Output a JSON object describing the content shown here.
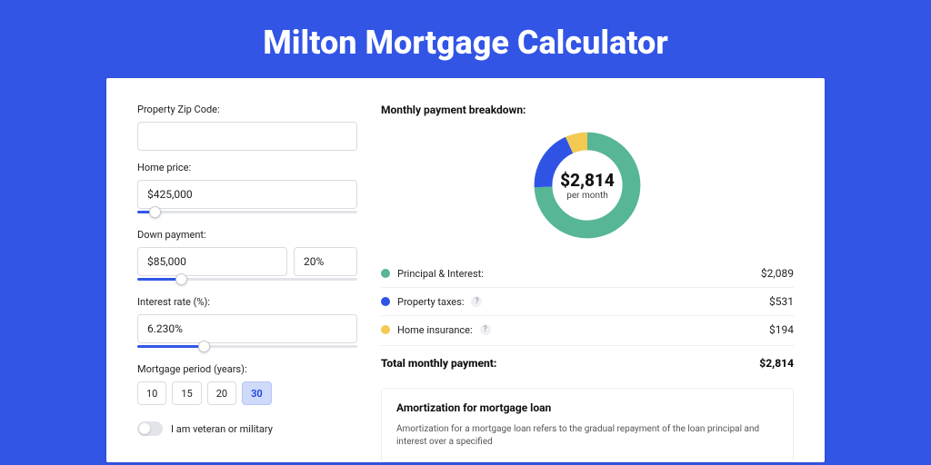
{
  "title": "Milton Mortgage Calculator",
  "form": {
    "zip": {
      "label": "Property Zip Code:",
      "value": ""
    },
    "price": {
      "label": "Home price:",
      "value": "$425,000",
      "slider_pct": 8
    },
    "down": {
      "label": "Down payment:",
      "value": "$85,000",
      "pct": "20%",
      "slider_pct": 20
    },
    "rate": {
      "label": "Interest rate (%):",
      "value": "6.230%",
      "slider_pct": 30
    },
    "period": {
      "label": "Mortgage period (years):",
      "options": [
        "10",
        "15",
        "20",
        "30"
      ],
      "selected": "30"
    },
    "veteran": {
      "label": "I am veteran or military",
      "on": false
    }
  },
  "breakdown": {
    "title": "Monthly payment breakdown:",
    "center_amount": "$2,814",
    "center_sub": "per month",
    "items": [
      {
        "label": "Principal & Interest:",
        "value": "$2,089",
        "color": "#56b695",
        "has_info": false
      },
      {
        "label": "Property taxes:",
        "value": "$531",
        "color": "#2f54e5",
        "has_info": true
      },
      {
        "label": "Home insurance:",
        "value": "$194",
        "color": "#f4c952",
        "has_info": true
      }
    ],
    "total_label": "Total monthly payment:",
    "total_value": "$2,814"
  },
  "chart_data": {
    "type": "pie",
    "title": "Monthly payment breakdown",
    "series": [
      {
        "name": "Principal & Interest",
        "value": 2089,
        "color": "#56b695"
      },
      {
        "name": "Property taxes",
        "value": 531,
        "color": "#2f54e5"
      },
      {
        "name": "Home insurance",
        "value": 194,
        "color": "#f4c952"
      }
    ],
    "total": 2814,
    "center_label": "$2,814 per month"
  },
  "amortization": {
    "title": "Amortization for mortgage loan",
    "text": "Amortization for a mortgage loan refers to the gradual repayment of the loan principal and interest over a specified"
  }
}
